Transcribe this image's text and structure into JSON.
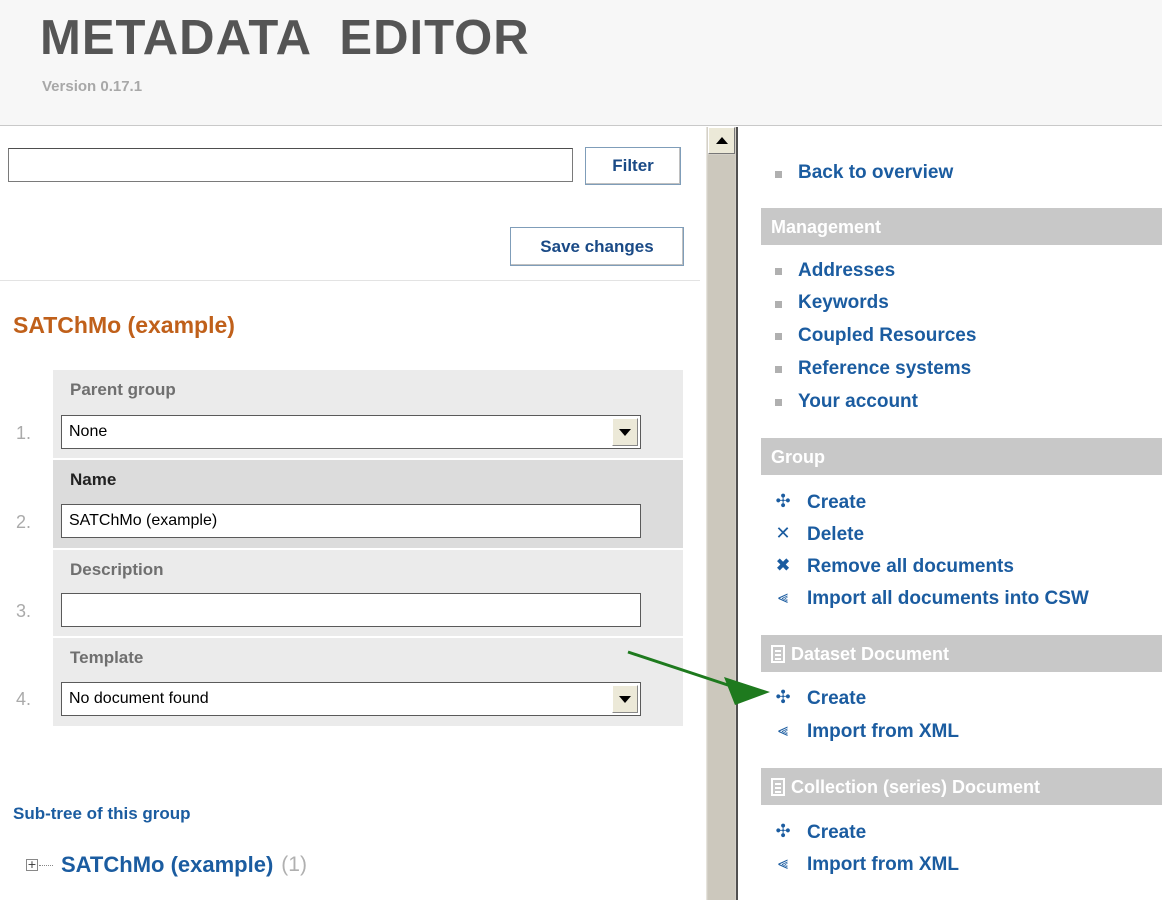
{
  "header": {
    "title": "METADATA  EDITOR",
    "version": "Version 0.17.1"
  },
  "left": {
    "filter": {
      "value": "",
      "placeholder": "",
      "button": "Filter"
    },
    "save_button": "Save changes",
    "group_title": "SATChMo (example)",
    "fields": [
      {
        "number": "1.",
        "label": "Parent group",
        "type": "select",
        "value": "None"
      },
      {
        "number": "2.",
        "label": "Name",
        "type": "text",
        "value": "SATChMo (example)"
      },
      {
        "number": "3.",
        "label": "Description",
        "type": "text",
        "value": ""
      },
      {
        "number": "4.",
        "label": "Template",
        "type": "select",
        "value": "No document found"
      }
    ],
    "subtree": {
      "heading": "Sub-tree of this group",
      "expander": "+",
      "item_label": "SATChMo (example)",
      "item_count": "(1)"
    }
  },
  "right": {
    "back_link": "Back to overview",
    "sections": {
      "management": {
        "header": "Management",
        "items": [
          "Addresses",
          "Keywords",
          "Coupled Resources",
          "Reference systems",
          "Your account"
        ]
      },
      "group": {
        "header": "Group",
        "actions": [
          {
            "icon": "plus-outline-icon",
            "glyph": "✣",
            "label": "Create"
          },
          {
            "icon": "delete-x-icon",
            "glyph": "✕",
            "label": "Delete"
          },
          {
            "icon": "remove-all-x-icon",
            "glyph": "✖",
            "label": "Remove all documents"
          },
          {
            "icon": "import-arrow-icon",
            "glyph": "⫷",
            "label": "Import all documents into CSW"
          }
        ]
      },
      "dataset": {
        "header": "Dataset Document",
        "icon": "document-icon",
        "actions": [
          {
            "icon": "plus-outline-icon",
            "glyph": "✣",
            "label": "Create"
          },
          {
            "icon": "import-arrow-icon",
            "glyph": "⫷",
            "label": "Import from XML"
          }
        ]
      },
      "collection": {
        "header": "Collection (series) Document",
        "icon": "document-icon",
        "actions": [
          {
            "icon": "plus-outline-icon",
            "glyph": "✣",
            "label": "Create"
          },
          {
            "icon": "import-arrow-icon",
            "glyph": "⫷",
            "label": "Import from XML"
          }
        ]
      }
    }
  },
  "colors": {
    "link": "#1b5ca0",
    "group_title": "#c0601a",
    "section_header_bg": "#c8c8c8",
    "annotation_arrow": "#1e7a1e"
  }
}
